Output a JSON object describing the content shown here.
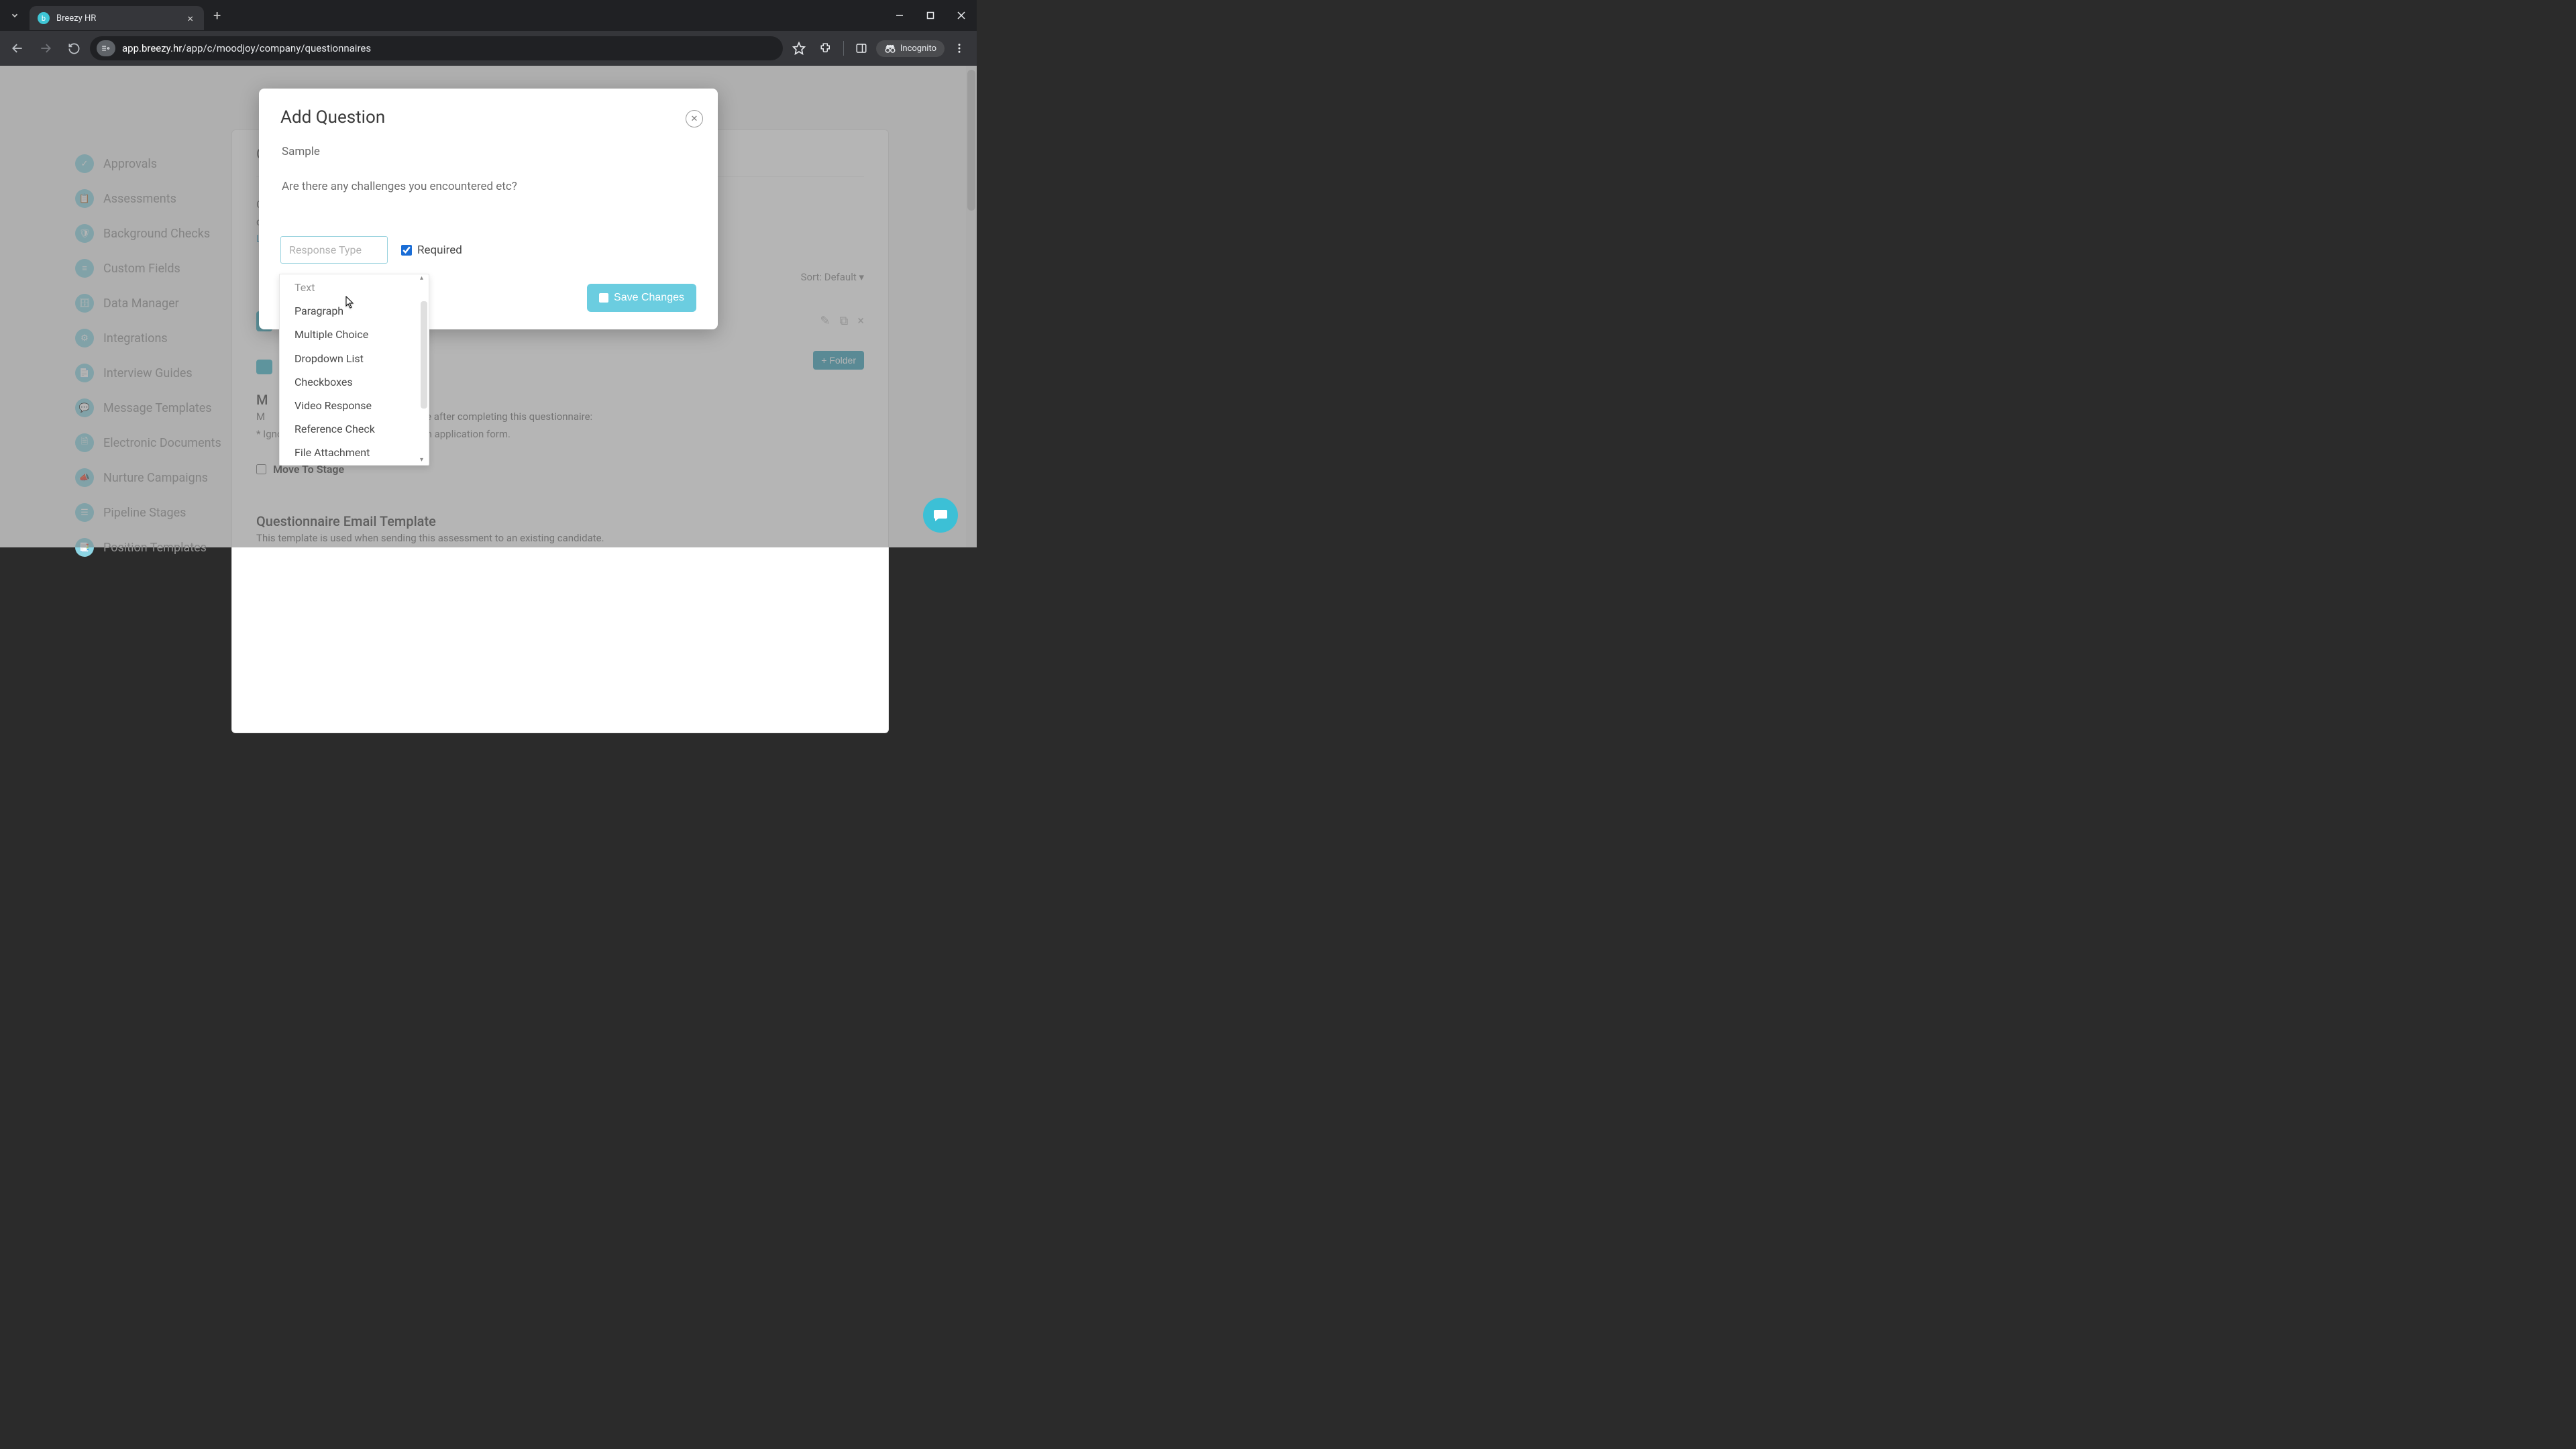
{
  "browser": {
    "tab_title": "Breezy HR",
    "url_prefix": "app.breezy.hr",
    "url_path": "/app/c/moodjoy/company/questionnaires",
    "incognito_label": "Incognito"
  },
  "sidebar": {
    "items": [
      {
        "label": "Approvals"
      },
      {
        "label": "Assessments"
      },
      {
        "label": "Background Checks"
      },
      {
        "label": "Custom Fields"
      },
      {
        "label": "Data Manager"
      },
      {
        "label": "Integrations"
      },
      {
        "label": "Interview Guides"
      },
      {
        "label": "Message Templates"
      },
      {
        "label": "Electronic Documents"
      },
      {
        "label": "Nurture Campaigns"
      },
      {
        "label": "Pipeline Stages"
      },
      {
        "label": "Position Templates"
      }
    ]
  },
  "main": {
    "header_first_char": "C",
    "desc_first_char": "C",
    "desc_second_line_first": "c",
    "learn_more_first": "L",
    "sort_label": "Sort: Default",
    "folder_btn": "+ Folder",
    "move_label_first": "M",
    "move_sub_line": "e after completing this questionnaire:",
    "ignored_note": "* Ignored when questionnaire is used in application form.",
    "move_to_stage": "Move To Stage",
    "email_title": "Questionnaire Email Template",
    "email_sub": "This template is used when sending this assessment to an existing candidate."
  },
  "modal": {
    "title": "Add Question",
    "question_label_value": "Sample",
    "question_text_value": "Are there any challenges you encountered etc?",
    "response_type_placeholder": "Response Type",
    "required_label": "Required",
    "required_checked": true,
    "save_label": "Save Changes"
  },
  "dropdown": {
    "partial_top": "Text",
    "options": [
      "Paragraph",
      "Multiple Choice",
      "Dropdown List",
      "Checkboxes",
      "Video Response",
      "Reference Check",
      "File Attachment"
    ]
  },
  "colors": {
    "accent_teal": "#3fb5c9",
    "accent_light": "#8dd5e3",
    "save_btn": "#6bcde0"
  }
}
